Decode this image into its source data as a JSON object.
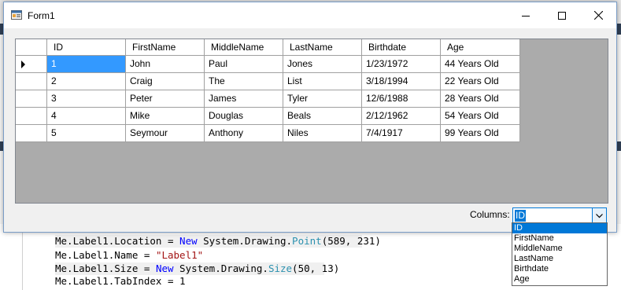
{
  "window": {
    "title": "Form1",
    "icon": "winforms-app-icon",
    "controls": {
      "minimize_icon": "minimize-icon",
      "maximize_icon": "maximize-icon",
      "close_icon": "close-icon"
    }
  },
  "grid": {
    "columns": [
      "ID",
      "FirstName",
      "MiddleName",
      "LastName",
      "Birthdate",
      "Age"
    ],
    "rows": [
      [
        "1",
        "John",
        "Paul",
        "Jones",
        "1/23/1972",
        "44 Years Old"
      ],
      [
        "2",
        "Craig",
        "The",
        "List",
        "3/18/1994",
        "22 Years Old"
      ],
      [
        "3",
        "Peter",
        "James",
        "Tyler",
        "12/6/1988",
        "28 Years Old"
      ],
      [
        "4",
        "Mike",
        "Douglas",
        "Beals",
        "2/12/1962",
        "54 Years Old"
      ],
      [
        "5",
        "Seymour",
        "Anthony",
        "Niles",
        "7/4/1917",
        "99 Years Old"
      ]
    ],
    "current_row_indicator": "current-row-arrow-icon",
    "selected_cell": "1"
  },
  "columns_filter": {
    "label": "Columns:",
    "selected": "ID",
    "options": [
      "ID",
      "FirstName",
      "MiddleName",
      "LastName",
      "Birthdate",
      "Age"
    ]
  },
  "code_editor": {
    "line1_prefix": "Me.Label1.Location = ",
    "line1_new": "New",
    "line1_mid": " System.Drawing.",
    "line1_type": "Point",
    "line1_args": "(589, 231)",
    "line2_prefix": "Me.Label1.Name = ",
    "line2_str": "\"Label1\"",
    "line3_prefix": "Me.Label1.Size = ",
    "line3_new": "New",
    "line3_mid": " System.Drawing.",
    "line3_type": "Size",
    "line3_args": "(50, 13)",
    "line4": "Me.Label1.TabIndex = 1"
  },
  "colors": {
    "selection": "#3399ff",
    "focus": "#0078d7",
    "grid_background": "#ababab"
  }
}
